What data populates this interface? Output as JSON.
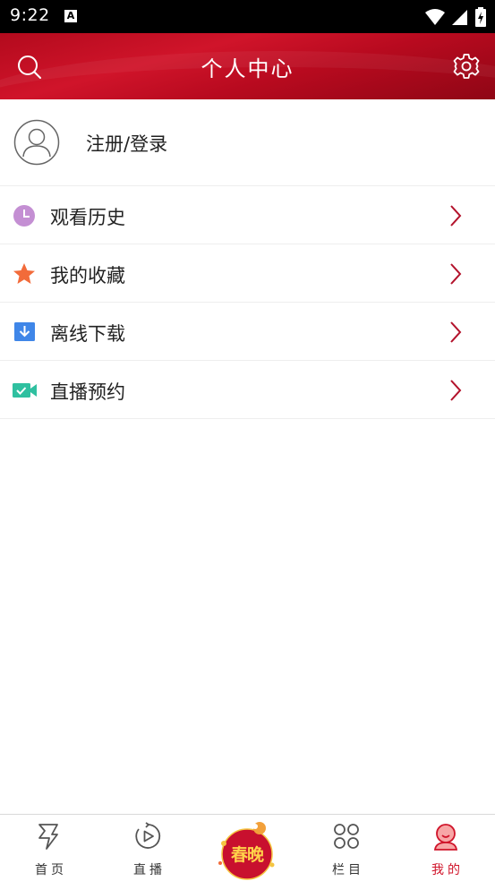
{
  "status_bar": {
    "time": "9:22",
    "notification_glyph": "A"
  },
  "header": {
    "title": "个人中心",
    "search_icon": "search-icon",
    "settings_icon": "gear-icon"
  },
  "login": {
    "label": "注册/登录",
    "icon": "avatar-icon"
  },
  "menu": {
    "items": [
      {
        "label": "观看历史",
        "icon": "clock-icon",
        "color": "#c48fd3"
      },
      {
        "label": "我的收藏",
        "icon": "star-icon",
        "color": "#f26b3a"
      },
      {
        "label": "离线下载",
        "icon": "download-icon",
        "color": "#3f86e8"
      },
      {
        "label": "直播预约",
        "icon": "video-camera-icon",
        "color": "#2fc0a0"
      }
    ],
    "chevron_color": "#b3122b"
  },
  "tabbar": {
    "tabs": [
      {
        "label": "首页",
        "icon": "home-icon"
      },
      {
        "label": "直播",
        "icon": "live-icon"
      },
      {
        "label": "春晚",
        "icon": "chunwan-logo"
      },
      {
        "label": "栏目",
        "icon": "columns-icon"
      },
      {
        "label": "我的",
        "icon": "profile-icon"
      }
    ],
    "active_color": "#d0142a"
  }
}
